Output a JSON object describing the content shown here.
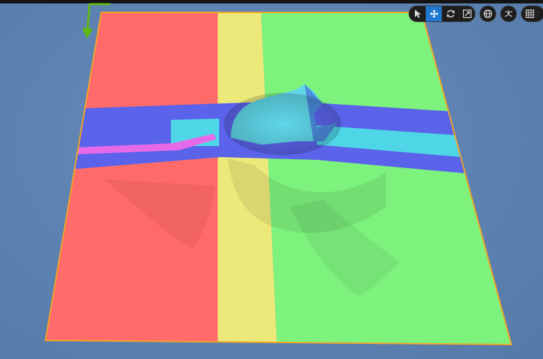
{
  "viewport": {
    "colors": {
      "background": "#6289b7",
      "zone_red": "#ff6a6a",
      "zone_yellow": "#ece97a",
      "zone_green": "#7df27d",
      "road_blue": "#5a63ea",
      "road_cyan": "#4fd6e6",
      "road_magenta": "#e66ae8",
      "border_orange": "#f5a623",
      "gizmo_green": "#5fb80f"
    }
  },
  "toolbar": {
    "transform_tools": [
      {
        "icon": "select-arrow-icon",
        "active": false
      },
      {
        "icon": "translate-move-icon",
        "active": true
      },
      {
        "icon": "rotate-icon",
        "active": false
      },
      {
        "icon": "scale-icon",
        "active": false
      }
    ],
    "world_space_icon": "globe-icon",
    "surface_snap_icon": "surface-snap-icon",
    "grid_snap_icon": "grid-icon"
  }
}
